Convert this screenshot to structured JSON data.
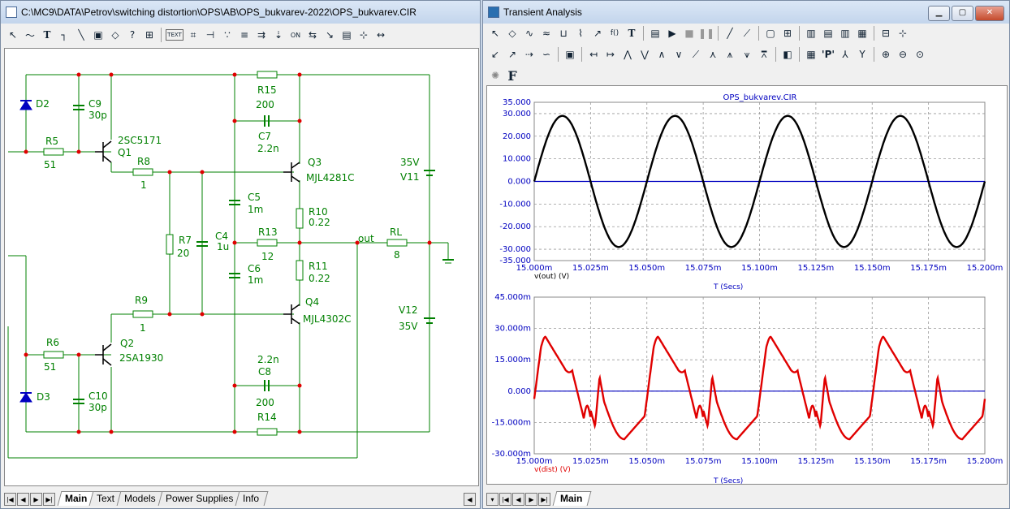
{
  "left_window": {
    "title": "C:\\MC9\\DATA\\Petrov\\switching distortion\\OPS\\AB\\OPS_bukvarev-2022\\OPS_bukvarev.CIR",
    "toolbar_text_button": "TEXT",
    "tabs": [
      "Main",
      "Text",
      "Models",
      "Power Supplies",
      "Info"
    ],
    "schematic": {
      "components": [
        {
          "ref": "D2",
          "value": ""
        },
        {
          "ref": "C9",
          "value": "30p"
        },
        {
          "ref": "R5",
          "value": "51"
        },
        {
          "ref": "Q1",
          "value": "2SC5171"
        },
        {
          "ref": "R8",
          "value": "1"
        },
        {
          "ref": "R15",
          "value": "200"
        },
        {
          "ref": "C7",
          "value": "2.2n"
        },
        {
          "ref": "Q3",
          "value": "MJL4281C"
        },
        {
          "ref": "C5",
          "value": "1m"
        },
        {
          "ref": "R10",
          "value": "0.22"
        },
        {
          "ref": "R7",
          "value": "20"
        },
        {
          "ref": "C4",
          "value": "1u"
        },
        {
          "ref": "R13",
          "value": "12"
        },
        {
          "ref": "C6",
          "value": "1m"
        },
        {
          "ref": "R11",
          "value": "0.22"
        },
        {
          "ref": "Q4",
          "value": "MJL4302C"
        },
        {
          "ref": "R9",
          "value": "1"
        },
        {
          "ref": "R6",
          "value": "51"
        },
        {
          "ref": "Q2",
          "value": "2SA1930"
        },
        {
          "ref": "D3",
          "value": ""
        },
        {
          "ref": "C10",
          "value": "30p"
        },
        {
          "ref": "C8",
          "value": "2.2n"
        },
        {
          "ref": "R14",
          "value": "200"
        },
        {
          "ref": "RL",
          "value": "8"
        },
        {
          "ref": "V11",
          "value": "35V"
        },
        {
          "ref": "V12",
          "value": "35V"
        }
      ],
      "node_out": "out"
    }
  },
  "right_window": {
    "title": "Transient Analysis",
    "font_button": "F",
    "tabs": [
      "Main"
    ],
    "plot_title": "OPS_bukvarev.CIR",
    "plot1": {
      "ylabels": [
        "35.000",
        "30.000",
        "20.000",
        "10.000",
        "0.000",
        "-10.000",
        "-20.000",
        "-30.000",
        "-35.000"
      ],
      "xlabels": [
        "15.000m",
        "15.025m",
        "15.050m",
        "15.075m",
        "15.100m",
        "15.125m",
        "15.150m",
        "15.175m",
        "15.200m"
      ],
      "trace_label": "v(out) (V)",
      "xaxis_label": "T (Secs)",
      "trace_color": "#000000"
    },
    "plot2": {
      "ylabels": [
        "45.000m",
        "30.000m",
        "15.000m",
        "0.000",
        "-15.000m",
        "-30.000m"
      ],
      "xlabels": [
        "15.000m",
        "15.025m",
        "15.050m",
        "15.075m",
        "15.100m",
        "15.125m",
        "15.150m",
        "15.175m",
        "15.200m"
      ],
      "trace_label": "v(dist) (V)",
      "xaxis_label": "T (Secs)",
      "trace_color": "#e00000"
    },
    "axis_text_color": "#0000c0"
  },
  "chart_data": [
    {
      "type": "line",
      "series": [
        {
          "name": "v(out) (V)",
          "amplitude": 29,
          "frequency_hz": 20000,
          "phase_deg": 0
        }
      ],
      "x_range": [
        0.015,
        0.0152
      ],
      "ylim": [
        -35,
        35
      ],
      "xlabel": "T (Secs)",
      "grid": true
    },
    {
      "type": "line",
      "series": [
        {
          "name": "v(dist) (V)",
          "peak": 0.026,
          "trough": -0.023
        }
      ],
      "x_range": [
        0.015,
        0.0152
      ],
      "ylim": [
        -0.03,
        0.045
      ],
      "xlabel": "T (Secs)",
      "grid": true
    }
  ]
}
